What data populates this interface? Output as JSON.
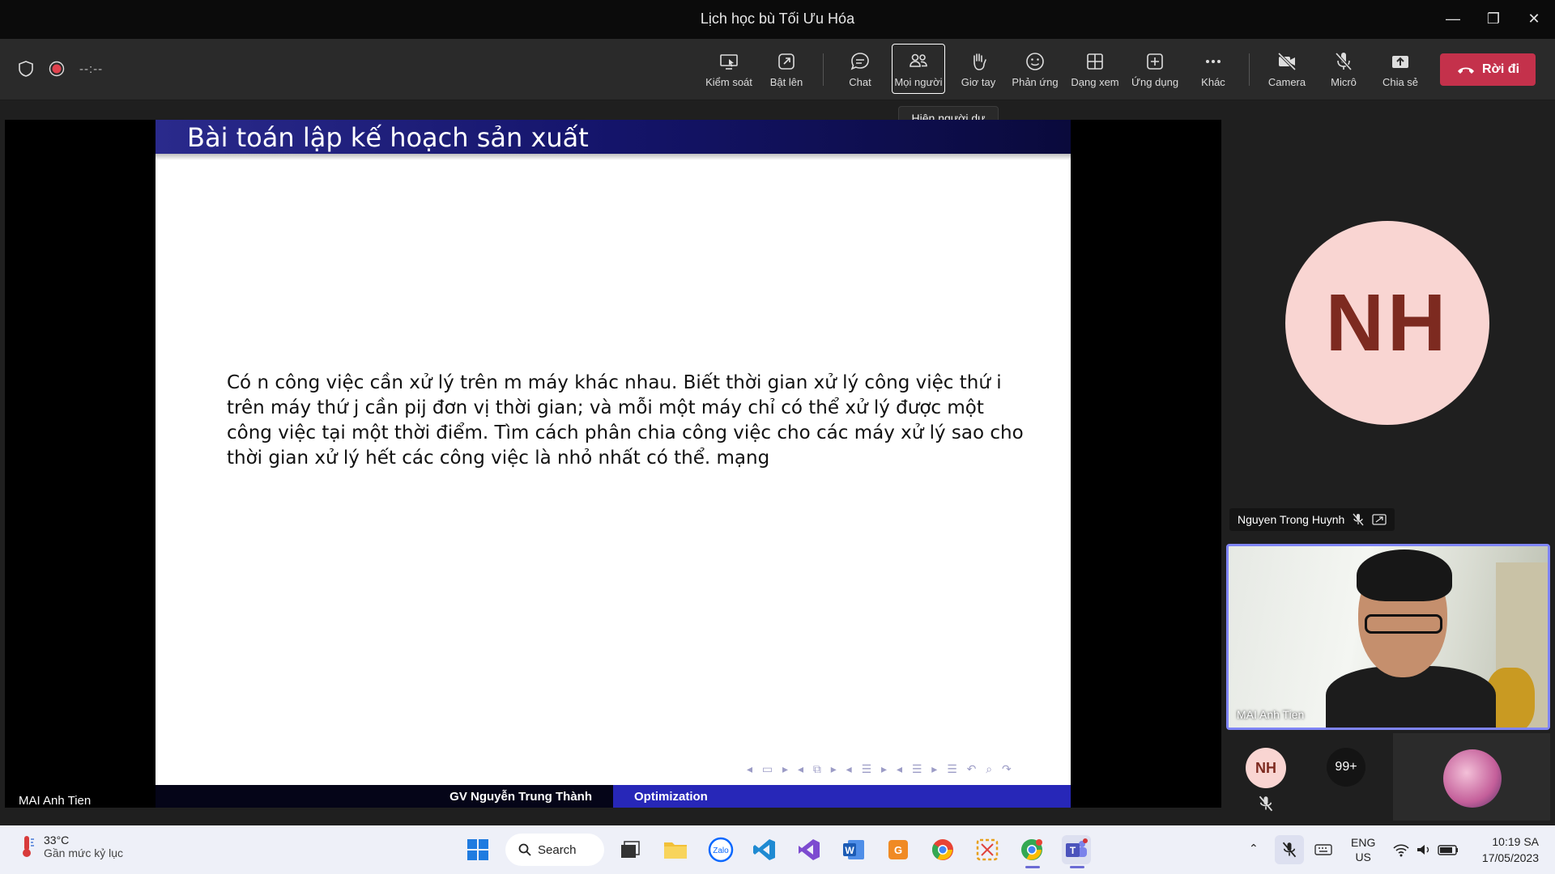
{
  "window": {
    "title": "Lịch học bù Tối Ưu Hóa"
  },
  "meeting": {
    "timer": "--:--"
  },
  "toolbar": {
    "items": [
      {
        "label": "Kiểm soát",
        "icon": "control-screen-icon"
      },
      {
        "label": "Bật lên",
        "icon": "pop-out-icon"
      },
      {
        "label": "Chat",
        "icon": "chat-icon"
      },
      {
        "label": "Mọi người",
        "icon": "people-icon"
      },
      {
        "label": "Giơ tay",
        "icon": "raise-hand-icon"
      },
      {
        "label": "Phản ứng",
        "icon": "reaction-icon"
      },
      {
        "label": "Dạng xem",
        "icon": "view-icon"
      },
      {
        "label": "Ứng dụng",
        "icon": "apps-icon"
      },
      {
        "label": "Khác",
        "icon": "more-icon"
      },
      {
        "label": "Camera",
        "icon": "camera-off-icon"
      },
      {
        "label": "Micrô",
        "icon": "mic-off-icon"
      },
      {
        "label": "Chia sẻ",
        "icon": "share-icon"
      }
    ],
    "leave_label": "Rời đi",
    "tooltip": "Hiện người dự"
  },
  "slide": {
    "title": "Bài toán lập kế hoạch sản xuất",
    "lines": [
      "Có n công việc cần xử lý trên m máy khác nhau. Biết thời gian xử lý công việc thứ i",
      "trên máy thứ j cần pij đơn vị thời gian; và mỗi một máy chỉ có thể xử lý được một",
      "công việc tại một thời điểm. Tìm cách phân chia công việc cho các máy xử lý sao cho",
      "thời gian xử lý hết các công việc là nhỏ nhất có thể. mạng"
    ],
    "footer_left": "GV Nguyễn Trung Thành",
    "footer_right": "Optimization"
  },
  "presenter_name": "MAI Anh Tien",
  "participants": {
    "big_initials": "NH",
    "big_name": "Nguyen Trong Huynh",
    "video_name": "MAI Anh Tien",
    "mini_initials": "NH",
    "more_count": "99+"
  },
  "taskbar": {
    "weather_temp": "33°C",
    "weather_desc": "Gần mức kỷ lục",
    "search_label": "Search",
    "lang_top": "ENG",
    "lang_bottom": "US",
    "time": "10:19 SA",
    "date": "17/05/2023"
  },
  "colors": {
    "leave": "#c4314b",
    "active_tile": "#7f85f5",
    "slide_foot_right": "#2727b8",
    "avatar_bg": "#f9d5d2",
    "avatar_text": "#7d2a20"
  }
}
